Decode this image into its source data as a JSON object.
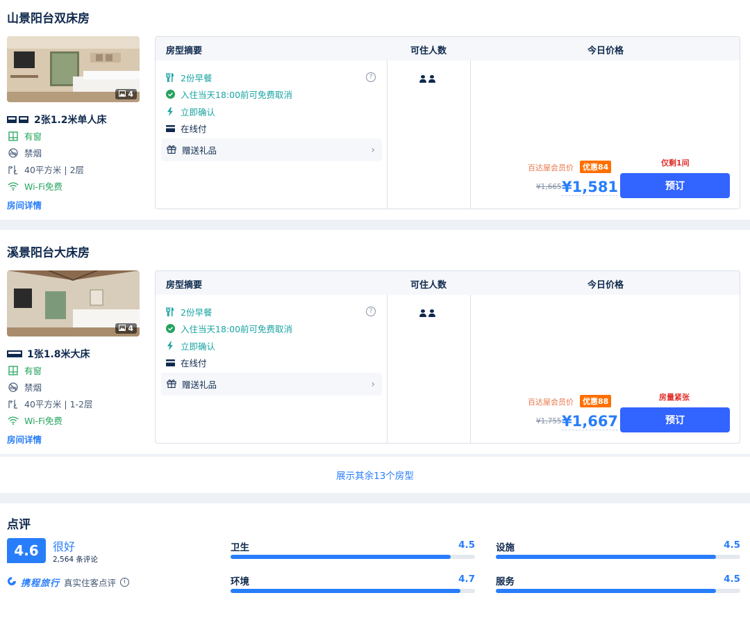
{
  "rooms": [
    {
      "title": "山景阳台双床房",
      "photo_count": "4",
      "bed": "2张1.2米单人床",
      "window": "有窗",
      "smoking": "禁烟",
      "area_floor": "40平方米 | 2层",
      "wifi": "Wi-Fi免费",
      "detail_link": "房间详情",
      "features": {
        "breakfast": "2份早餐",
        "cancel": "入住当天18:00前可免费取消",
        "confirm": "立即确认",
        "payment": "在线付",
        "gift": "赠送礼品"
      },
      "member_label": "百达屋会员价",
      "discount": "优惠84",
      "original_price": "¥1,665",
      "price": "¥1,581",
      "stock_note": "仅剩1间",
      "book_label": "预订"
    },
    {
      "title": "溪景阳台大床房",
      "photo_count": "4",
      "bed": "1张1.8米大床",
      "window": "有窗",
      "smoking": "禁烟",
      "area_floor": "40平方米 | 1-2层",
      "wifi": "Wi-Fi免费",
      "detail_link": "房间详情",
      "features": {
        "breakfast": "2份早餐",
        "cancel": "入住当天18:00前可免费取消",
        "confirm": "立即确认",
        "payment": "在线付",
        "gift": "赠送礼品"
      },
      "member_label": "百达屋会员价",
      "discount": "优惠88",
      "original_price": "¥1,755",
      "price": "¥1,667",
      "stock_note": "房量紧张",
      "book_label": "预订"
    }
  ],
  "table_headers": {
    "summary": "房型摘要",
    "occupancy": "可住人数",
    "price": "今日价格"
  },
  "more_rooms": "展示其余13个房型",
  "reviews": {
    "title": "点评",
    "score": "4.6",
    "score_word": "很好",
    "count": "2,564 条评论",
    "brand": "携程旅行",
    "brand_note": "真实住客点评",
    "sub_scores": [
      {
        "label": "卫生",
        "value": "4.5",
        "level": 0.9
      },
      {
        "label": "设施",
        "value": "4.5",
        "level": 0.9
      },
      {
        "label": "环境",
        "value": "4.7",
        "level": 0.94
      },
      {
        "label": "服务",
        "value": "4.5",
        "level": 0.9
      }
    ]
  },
  "colors": {
    "accent": "#287dfa",
    "book_button": "#3264ff",
    "discount": "#ff6f00",
    "stock_warning": "#e0302d"
  }
}
